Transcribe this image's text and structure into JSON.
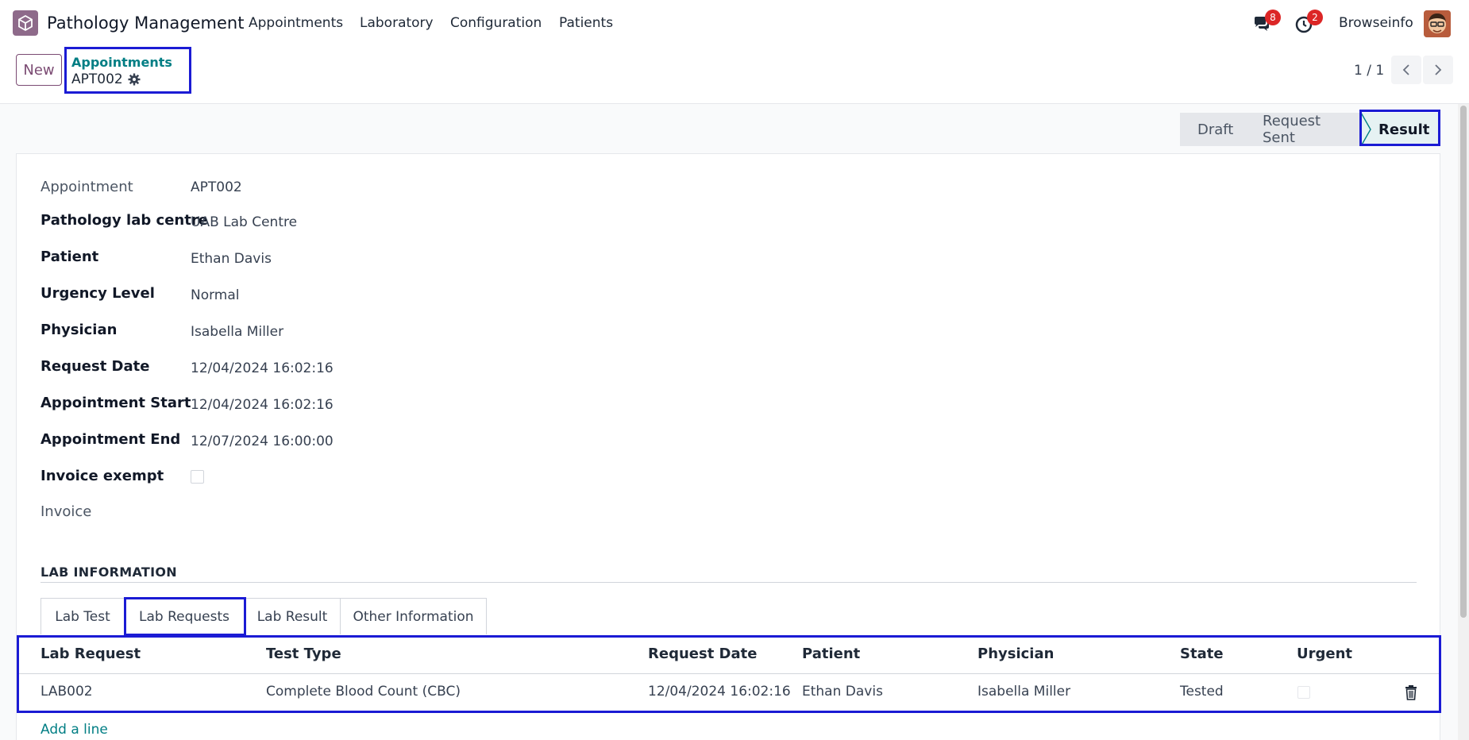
{
  "navbar": {
    "app_name": "Pathology Management",
    "menu": [
      "Appointments",
      "Laboratory",
      "Configuration",
      "Patients"
    ],
    "messages_count": "8",
    "activities_count": "2",
    "user_name": "Browseinfo"
  },
  "control_panel": {
    "new_label": "New",
    "breadcrumb_parent": "Appointments",
    "breadcrumb_current": "APT002",
    "pager": "1 / 1"
  },
  "status": {
    "stages": [
      "Draft",
      "Request Sent",
      "Result"
    ],
    "active": "Result"
  },
  "form": {
    "appointment_label": "Appointment",
    "appointment_value": "APT002",
    "lab_centre_label": "Pathology lab centre",
    "lab_centre_value": "UAB Lab Centre",
    "patient_label": "Patient",
    "patient_value": "Ethan Davis",
    "urgency_label": "Urgency Level",
    "urgency_value": "Normal",
    "physician_label": "Physician",
    "physician_value": "Isabella Miller",
    "request_date_label": "Request Date",
    "request_date_value": "12/04/2024 16:02:16",
    "appt_start_label": "Appointment Start",
    "appt_start_value": "12/04/2024 16:02:16",
    "appt_end_label": "Appointment End",
    "appt_end_value": "12/07/2024 16:00:00",
    "invoice_exempt_label": "Invoice exempt",
    "invoice_exempt_checked": false,
    "invoice_label": "Invoice"
  },
  "lab_section": {
    "title": "LAB INFORMATION",
    "tabs": [
      "Lab Test",
      "Lab Requests",
      "Lab Result",
      "Other Information"
    ],
    "active_tab": "Lab Requests",
    "columns": [
      "Lab Request",
      "Test Type",
      "Request Date",
      "Patient",
      "Physician",
      "State",
      "Urgent"
    ],
    "rows": [
      {
        "lab_request": "LAB002",
        "test_type": "Complete Blood Count (CBC)",
        "request_date": "12/04/2024 16:02:16",
        "patient": "Ethan Davis",
        "physician": "Isabella Miller",
        "state": "Tested",
        "urgent": false
      }
    ],
    "add_line": "Add a line"
  },
  "colors": {
    "accent": "#017e84",
    "brand": "#7b4b73",
    "highlight": "#1b1bd4",
    "badge": "#dc2626"
  }
}
